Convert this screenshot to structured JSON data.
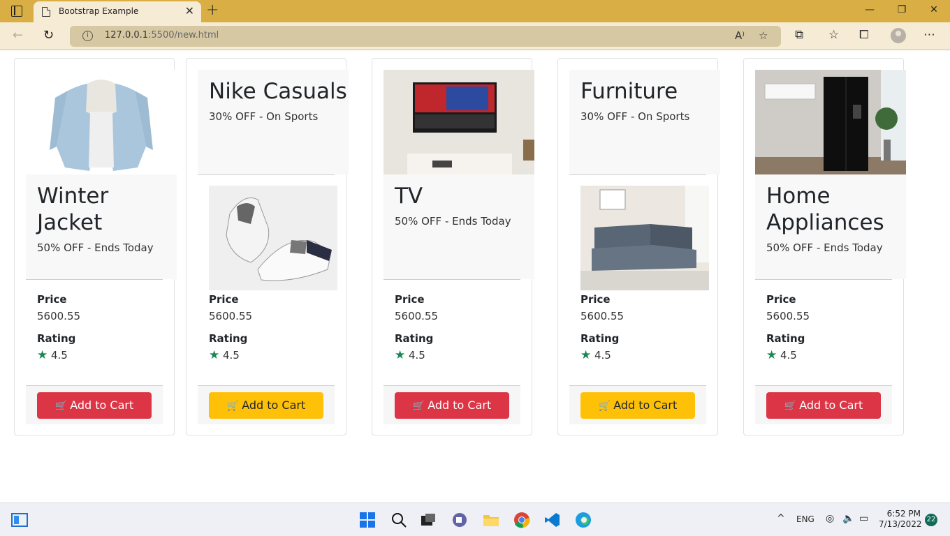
{
  "browser": {
    "tab_title": "Bootstrap Example",
    "url_host": "127.0.0.1",
    "url_rest": ":5500/new.html"
  },
  "cards": [
    {
      "title": "Winter Jacket",
      "subtitle": "50% OFF - Ends Today",
      "price_label": "Price",
      "price": "5600.55",
      "rating_label": "Rating",
      "rating": "4.5",
      "button": "Add to Cart",
      "button_color": "#dc3545"
    },
    {
      "title": "Nike Casuals",
      "subtitle": "30% OFF - On Sports",
      "price_label": "Price",
      "price": "5600.55",
      "rating_label": "Rating",
      "rating": "4.5",
      "button": "Add to Cart",
      "button_color": "#ffc107"
    },
    {
      "title": "TV",
      "subtitle": "50% OFF - Ends Today",
      "price_label": "Price",
      "price": "5600.55",
      "rating_label": "Rating",
      "rating": "4.5",
      "button": "Add to Cart",
      "button_color": "#dc3545"
    },
    {
      "title": "Furniture",
      "subtitle": "30% OFF - On Sports",
      "price_label": "Price",
      "price": "5600.55",
      "rating_label": "Rating",
      "rating": "4.5",
      "button": "Add to Cart",
      "button_color": "#ffc107"
    },
    {
      "title": "Home Appliances",
      "subtitle": "50% OFF - Ends Today",
      "price_label": "Price",
      "price": "5600.55",
      "rating_label": "Rating",
      "rating": "4.5",
      "button": "Add to Cart",
      "button_color": "#dc3545"
    }
  ],
  "taskbar": {
    "language": "ENG",
    "time": "6:52 PM",
    "date": "7/13/2022",
    "notifications": "22"
  }
}
